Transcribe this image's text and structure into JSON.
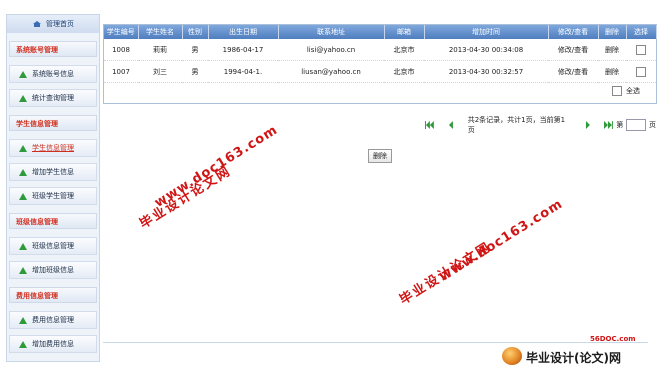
{
  "sidebar": {
    "header": "管理首页",
    "sections": [
      {
        "title": "系统账号管理",
        "items": [
          "系统账号信息",
          "统计查询管理"
        ]
      },
      {
        "title": "学生信息管理",
        "items": [
          "学生信息管理",
          "增加学生信息",
          "班级学生管理"
        ]
      },
      {
        "title": "班级信息管理",
        "items": [
          "班级信息管理",
          "增加班级信息"
        ]
      },
      {
        "title": "费用信息管理",
        "items": [
          "费用信息管理",
          "增加费用信息"
        ]
      }
    ]
  },
  "table": {
    "columns": [
      "学生编号",
      "学生姓名",
      "性别",
      "出生日期",
      "联系地址",
      "邮箱",
      "增加时间",
      "修改/查看",
      "删除",
      "选择"
    ],
    "rows": [
      {
        "id": "1008",
        "name": "莉莉",
        "gender": "男",
        "birth": "1986-04-17",
        "address": "lisi@yahoo.cn",
        "email": "北京市",
        "added": "2013-04-30 00:34:08",
        "edit": "修改/查看",
        "delete": "删除"
      },
      {
        "id": "1007",
        "name": "刘三",
        "gender": "男",
        "birth": "1994-04-1.",
        "address": "liusan@yahoo.cn",
        "email": "北京市",
        "added": "2013-04-30 00:32:57",
        "edit": "修改/查看",
        "delete": "删除"
      }
    ],
    "select_all": "全选"
  },
  "pager": {
    "summary": "共2条记录，共计1页，当前第1页",
    "goto_prefix": "第",
    "goto_suffix": "页"
  },
  "delete_button": "删除",
  "watermarks": {
    "cn": "毕业设计论文网",
    "en": "www.doc163.com",
    "site": "56DOC.com",
    "brand": "毕业设计(论文)网"
  },
  "colors": {
    "header_blue": "#5b86c6",
    "section_red": "#d23020",
    "watermark_red": "#d01515"
  }
}
